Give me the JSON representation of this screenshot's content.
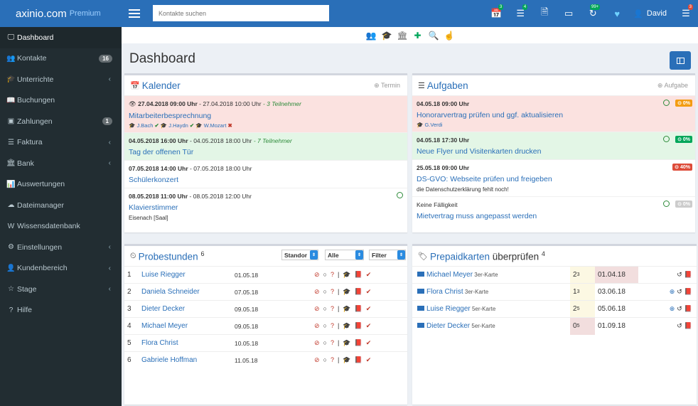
{
  "brand": {
    "name": "axinio.com",
    "sub": "Premium"
  },
  "search": {
    "placeholder": "Kontakte suchen"
  },
  "topbar": {
    "icons": [
      {
        "icon": "calendar-icon",
        "badge": "3",
        "badge_color": "#00a65a"
      },
      {
        "icon": "list-icon",
        "badge": "4",
        "badge_color": "#00a65a"
      },
      {
        "icon": "file-icon",
        "badge": ""
      },
      {
        "icon": "card-icon",
        "badge": ""
      },
      {
        "icon": "refresh-icon",
        "badge": "99+",
        "badge_color": "#00a65a"
      },
      {
        "icon": "heart-icon",
        "badge": ""
      }
    ],
    "user": "David",
    "menu_badge": "3"
  },
  "sidebar": {
    "items": [
      {
        "label": "Dashboard",
        "icon": "dashboard-icon",
        "active": true
      },
      {
        "label": "Kontakte",
        "icon": "users-icon",
        "count": "16"
      },
      {
        "label": "Unterrichte",
        "icon": "graduation-cap-icon",
        "chevron": true
      },
      {
        "label": "Buchungen",
        "icon": "book-icon"
      },
      {
        "label": "Zahlungen",
        "icon": "money-icon",
        "count": "1"
      },
      {
        "label": "Faktura",
        "icon": "list-icon",
        "chevron": true
      },
      {
        "label": "Bank",
        "icon": "bank-icon",
        "chevron": true
      },
      {
        "label": "Auswertungen",
        "icon": "chart-icon"
      },
      {
        "label": "Dateimanager",
        "icon": "cloud-icon"
      },
      {
        "label": "Wissensdatenbank",
        "icon": "wikipedia-icon"
      },
      {
        "label": "Einstellungen",
        "icon": "gear-icon",
        "chevron": true
      },
      {
        "label": "Kundenbereich",
        "icon": "user-icon",
        "chevron": true
      },
      {
        "label": "Stage",
        "icon": "star-icon",
        "chevron": true
      },
      {
        "label": "Hilfe",
        "icon": "question-icon"
      }
    ]
  },
  "page": {
    "title": "Dashboard"
  },
  "kalender": {
    "title": "Kalender",
    "action": "Termin",
    "events": [
      {
        "start": "27.04.2018 09:00 Uhr",
        "end": " - 27.04.2018 10:00 Uhr",
        "info": " - 3 Teilnehmer",
        "name": "Mitarbeiterbesprechnung",
        "bg": "pink",
        "tags": [
          {
            "name": "J.Bach",
            "mark": "✔"
          },
          {
            "name": "J.Haydn",
            "mark": "✔"
          },
          {
            "name": "W.Mozart",
            "mark": "✖"
          }
        ]
      },
      {
        "start": "04.05.2018 16:00 Uhr",
        "end": " - 04.05.2018 18:00 Uhr",
        "info": " - 7 Teilnehmer",
        "name": "Tag der offenen Tür",
        "bg": "green"
      },
      {
        "start": "07.05.2018 14:00 Uhr",
        "end": " - 07.05.2018 18:00 Uhr",
        "info": "",
        "name": "Schülerkonzert",
        "bg": "white"
      },
      {
        "start": "08.05.2018 11:00 Uhr",
        "end": " - 08.05.2018 12:00 Uhr",
        "info": "",
        "name": "Klavierstimmer",
        "note": "Eisenach [Saal]",
        "bg": "white"
      }
    ]
  },
  "aufgaben": {
    "title": "Aufgaben",
    "action": "Aufgabe",
    "tasks": [
      {
        "date": "04.05.18 09:00 Uhr",
        "name": "Honorarvertrag prüfen und ggf. aktualisieren",
        "tag": "G.Verdi",
        "percent": "0%",
        "color": "orange",
        "bg": "pink"
      },
      {
        "date": "04.05.18 17:30 Uhr",
        "name": "Neue Flyer und Visitenkarten drucken",
        "percent": "0%",
        "color": "green",
        "bg": "green"
      },
      {
        "date": "25.05.18 09:00 Uhr",
        "name": "DS-GVO: Webseite prüfen und freigeben",
        "note": "die Datenschutzerklärung fehlt noch!",
        "percent": "40%",
        "color": "red",
        "bg": "white"
      },
      {
        "date": "Keine Fälligkeit",
        "name": "Mietvertrag muss angepasst werden",
        "percent": "0%",
        "color": "gray",
        "bg": "white"
      }
    ]
  },
  "probestunden": {
    "title": "Probestunden",
    "count": "6",
    "filters": [
      "Standor",
      "Alle",
      "Filter"
    ],
    "rows": [
      {
        "no": "1",
        "name": "Luise Riegger",
        "date": "01.05.18"
      },
      {
        "no": "2",
        "name": "Daniela Schneider",
        "date": "07.05.18"
      },
      {
        "no": "3",
        "name": "Dieter Decker",
        "date": "09.05.18"
      },
      {
        "no": "4",
        "name": "Michael Meyer",
        "date": "09.05.18"
      },
      {
        "no": "5",
        "name": "Flora Christ",
        "date": "10.05.18"
      },
      {
        "no": "6",
        "name": "Gabriele Hoffman",
        "date": "11.05.18"
      }
    ]
  },
  "prepaid": {
    "title_link": "Prepaidkarten",
    "title_rest": " überprüfen",
    "count": "4",
    "rows": [
      {
        "name": "Michael Meyer",
        "card": " 3er-Karte",
        "used": "2",
        "total": "3",
        "date": "01.04.18",
        "cnt_bg": "#fcf8e3",
        "date_bg": "#f2dede",
        "plus": false
      },
      {
        "name": "Flora Christ",
        "card": " 3er-Karte",
        "used": "1",
        "total": "3",
        "date": "03.06.18",
        "cnt_bg": "#fcf8e3",
        "date_bg": "#ffffff",
        "plus": true
      },
      {
        "name": "Luise Riegger",
        "card": " 5er-Karte",
        "used": "2",
        "total": "5",
        "date": "05.06.18",
        "cnt_bg": "#fcf8e3",
        "date_bg": "#ffffff",
        "plus": true
      },
      {
        "name": "Dieter Decker",
        "card": " 5er-Karte",
        "used": "0",
        "total": "5",
        "date": "01.09.18",
        "cnt_bg": "#f2dede",
        "date_bg": "#ffffff",
        "plus": false
      }
    ]
  }
}
